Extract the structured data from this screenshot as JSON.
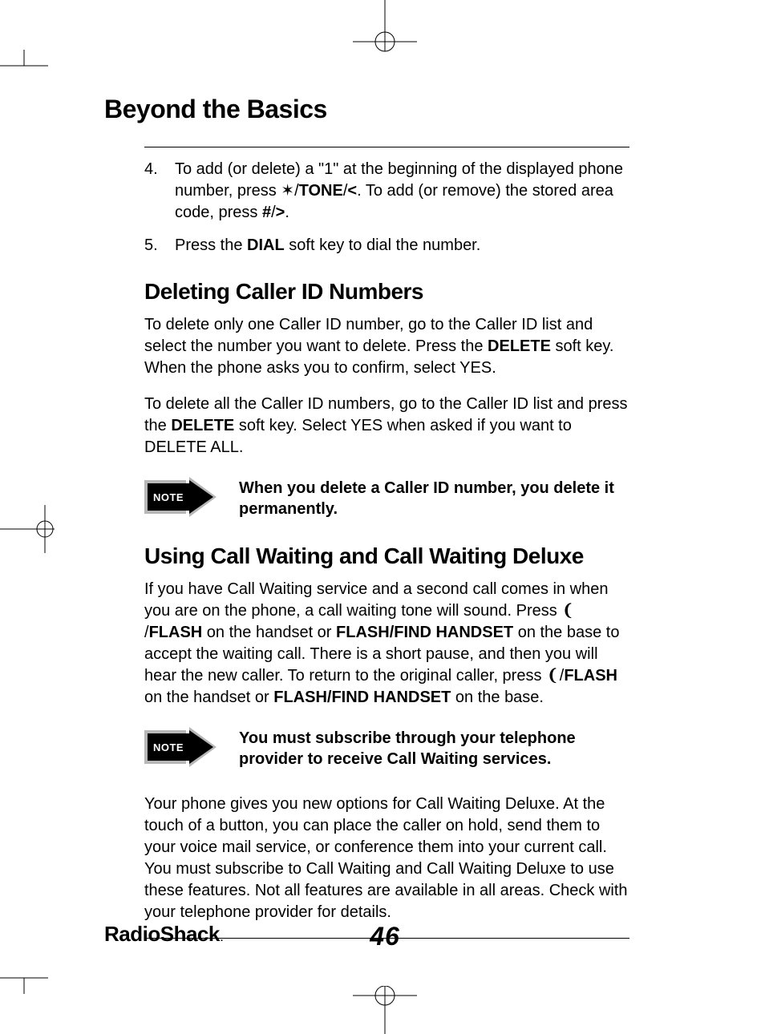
{
  "page_title": "Beyond the Basics",
  "step4_num": "4.",
  "step4_a": "To add (or delete) a \"1\" at the beginning of the displayed phone number, press ",
  "step4_b": "/",
  "step4_tone": "TONE",
  "step4_c": "/",
  "step4_lt": "<",
  "step4_d": ". To add (or remove) the stored area code, press ",
  "step4_hash": "#",
  "step4_e": "/",
  "step4_gt": ">",
  "step4_f": ".",
  "step5_num": "5.",
  "step5_a": "Press the ",
  "step5_dial": "DIAL",
  "step5_b": " soft key to dial the number.",
  "h_delete": "Deleting Caller ID Numbers",
  "del_p1_a": "To delete only one Caller ID number, go to the Caller ID list and select the number you want to delete. Press the ",
  "del_p1_delete": "DELETE",
  "del_p1_b": " soft key. When the phone asks you to confirm, select YES.",
  "del_p2_a": "To delete all the Caller ID numbers, go to the Caller ID list and press the ",
  "del_p2_delete": "DELETE",
  "del_p2_b": " soft key. Select YES when asked if you want to DELETE ALL.",
  "note_label": "NOTE",
  "note1_text": "When you delete a Caller ID number, you delete it permanently.",
  "h_cw": "Using Call Waiting and Call Waiting Deluxe",
  "cw_p1_a": "If you have Call Waiting service and a second call comes in when you are on the phone, a call waiting tone will sound. Press ",
  "cw_p1_b": " /",
  "cw_flash1": "FLASH",
  "cw_p1_c": " on the handset or ",
  "cw_ffh1": "FLASH/FIND HANDSET",
  "cw_p1_d": " on the base to accept the waiting call. There is a short pause, and then you will hear the new caller. To return to the original caller, press ",
  "cw_p1_e": "/",
  "cw_flash2": "FLASH",
  "cw_p1_f": " on the handset or ",
  "cw_ffh2": "FLASH/FIND HANDSET",
  "cw_p1_g": " on the base.",
  "note2_text": "You must subscribe through your telephone provider to receive Call Waiting services.",
  "cw_p3": "Your phone gives you new options for Call Waiting Deluxe. At the touch of a button, you can place the caller on hold, send them to your voice mail service, or conference them into your current call. You must subscribe to Call Waiting and Call Waiting Deluxe to use these features. Not all features are available in all areas. Check with your telephone provider for details.",
  "brand": "RadioShack",
  "page_number": "46",
  "star_glyph": "✶",
  "phone_glyph": "❨"
}
